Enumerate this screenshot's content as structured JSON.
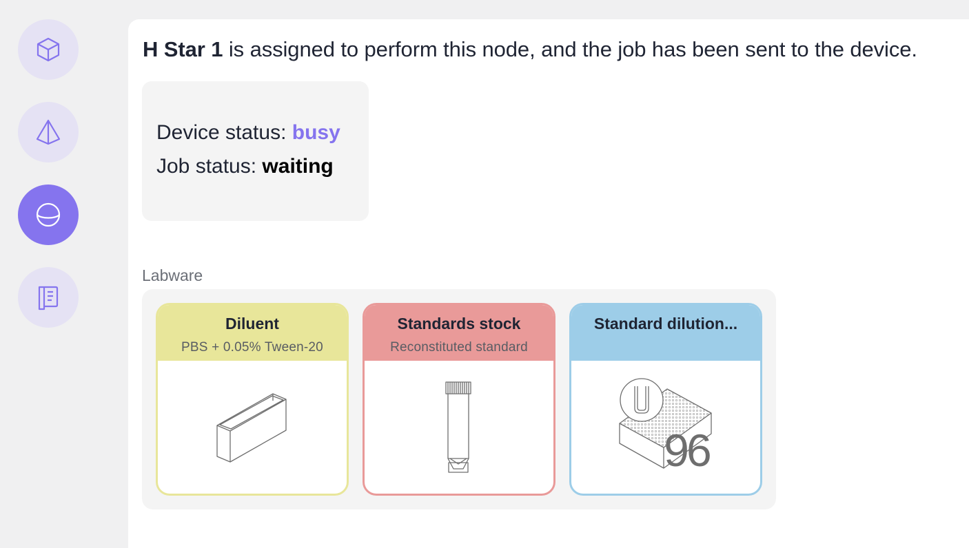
{
  "sidebar": {
    "items": [
      {
        "icon": "cube-icon",
        "active": false
      },
      {
        "icon": "pyramid-icon",
        "active": false
      },
      {
        "icon": "sphere-icon",
        "active": true
      },
      {
        "icon": "notebook-icon",
        "active": false
      }
    ]
  },
  "header": {
    "device_name": "H Star 1",
    "message": " is assigned to perform this node, and the job has been sent to the device."
  },
  "status": {
    "device_label": "Device status: ",
    "device_value": "busy",
    "job_label": "Job status: ",
    "job_value": "waiting"
  },
  "labware": {
    "title": "Labware",
    "items": [
      {
        "title": "Diluent",
        "subtitle": "PBS + 0.05% Tween-20",
        "color": "#e8e69a",
        "icon": "reservoir-icon"
      },
      {
        "title": "Standards stock",
        "subtitle": "Reconstituted standard",
        "color": "#e99a99",
        "icon": "tube-icon"
      },
      {
        "title": "Standard dilution...",
        "subtitle": "",
        "color": "#9dcde8",
        "icon": "96-well-plate-icon",
        "plate_label": "96"
      }
    ]
  },
  "colors": {
    "accent": "#8574ee",
    "accent_light": "#e5e2f4"
  }
}
